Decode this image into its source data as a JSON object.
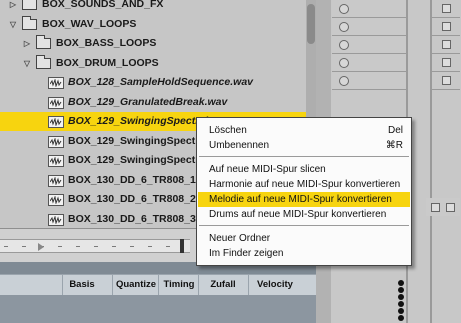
{
  "browser": {
    "rows": [
      {
        "type": "folder",
        "expanded": false,
        "label": "BOX_SOUNDS_AND_FX",
        "indent": 0
      },
      {
        "type": "folder",
        "expanded": true,
        "label": "BOX_WAV_LOOPS",
        "indent": 0
      },
      {
        "type": "folder",
        "expanded": false,
        "label": "BOX_BASS_LOOPS",
        "indent": 1
      },
      {
        "type": "folder",
        "expanded": true,
        "label": "BOX_DRUM_LOOPS",
        "indent": 1
      },
      {
        "type": "file",
        "label": "BOX_128_SampleHoldSequence.wav",
        "italic": true
      },
      {
        "type": "file",
        "label": "BOX_129_GranulatedBreak.wav",
        "italic": true
      },
      {
        "type": "file",
        "label": "BOX_129_SwingingSpectralDrums1.wav",
        "italic": true,
        "selected": true
      },
      {
        "type": "file",
        "label": "BOX_129_SwingingSpectral",
        "italic": false
      },
      {
        "type": "file",
        "label": "BOX_129_SwingingSpectral",
        "italic": false
      },
      {
        "type": "file",
        "label": "BOX_130_DD_6_TR808_1.w",
        "italic": false
      },
      {
        "type": "file",
        "label": "BOX_130_DD_6_TR808_2.w",
        "italic": false
      },
      {
        "type": "file",
        "label": "BOX_130_DD_6_TR808_3.w",
        "italic": false
      },
      {
        "type": "file",
        "label": "BOX_130_DD_6_TR808_4.w",
        "italic": false
      }
    ]
  },
  "columns": {
    "headers": [
      "Basis",
      "Quantize",
      "Timing",
      "Zufall",
      "Velocity"
    ]
  },
  "context_menu": {
    "groups": [
      [
        {
          "label": "Löschen",
          "shortcut": "Del"
        },
        {
          "label": "Umbenennen",
          "shortcut": "⌘R"
        }
      ],
      [
        {
          "label": "Auf neue MIDI-Spur slicen"
        },
        {
          "label": "Harmonie auf neue MIDI-Spur konvertieren"
        },
        {
          "label": "Melodie auf neue MIDI-Spur konvertieren",
          "highlighted": true
        },
        {
          "label": "Drums auf neue MIDI-Spur konvertieren"
        }
      ],
      [
        {
          "label": "Neuer Ordner"
        },
        {
          "label": "Im Finder zeigen"
        }
      ]
    ]
  },
  "colors": {
    "selection": "#f7d40f",
    "browser_bg": "#c6c6c6"
  }
}
